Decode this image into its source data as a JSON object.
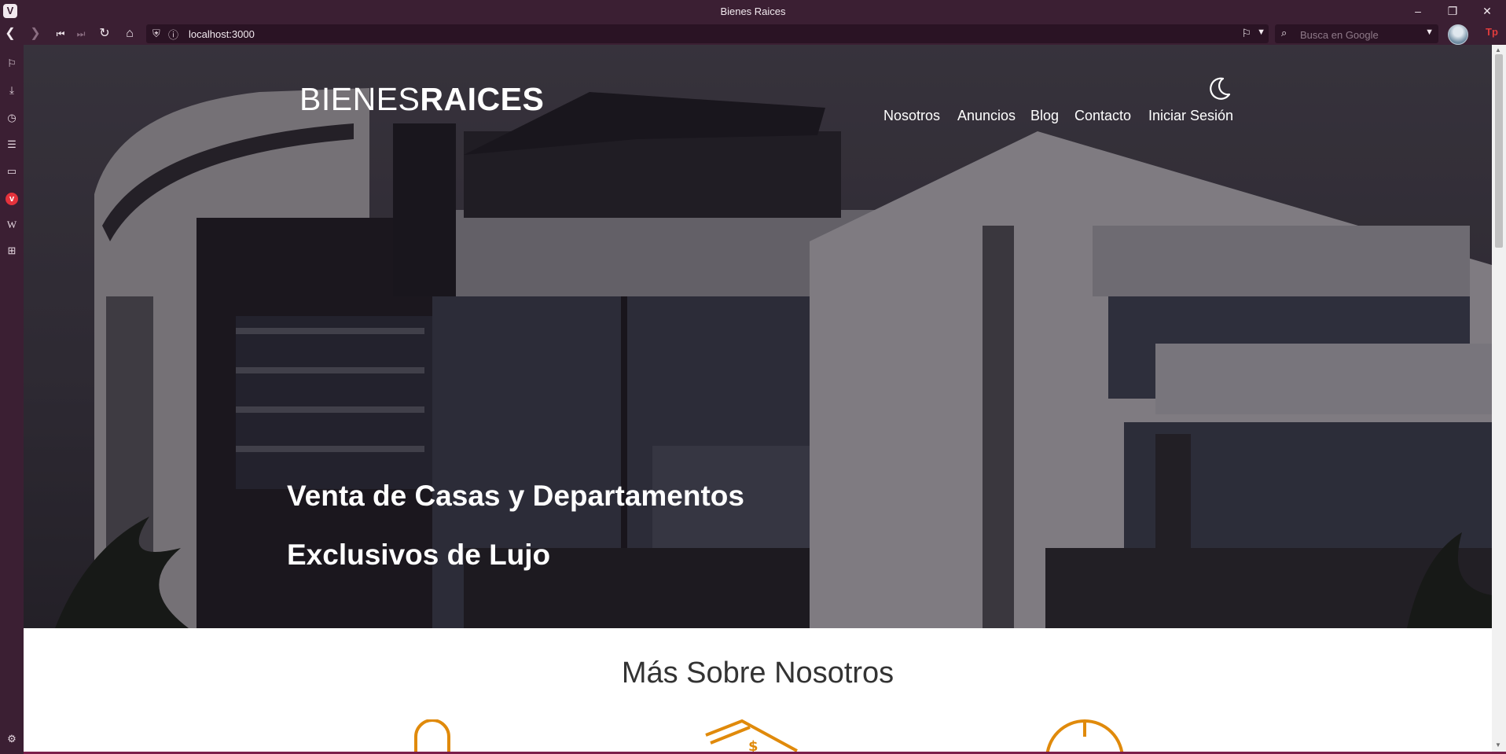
{
  "browser": {
    "window_title": "Bienes Raices",
    "logo_letter": "V",
    "url": "localhost:3000",
    "search_placeholder": "Busca en Google",
    "extension_label": "Tp"
  },
  "site": {
    "logo_thin": "BIENES",
    "logo_bold": "RAICES",
    "nav": [
      "Nosotros",
      "Anuncios",
      "Blog",
      "Contacto",
      "Iniciar Sesión"
    ],
    "hero_line1": "Venta de Casas y Departamentos",
    "hero_line2": "Exclusivos de Lujo",
    "section_title": "Más Sobre Nosotros"
  },
  "colors": {
    "browser_chrome": "#3b1f33",
    "accent_icons": "#e08a0b",
    "hero_text": "#ffffff"
  }
}
